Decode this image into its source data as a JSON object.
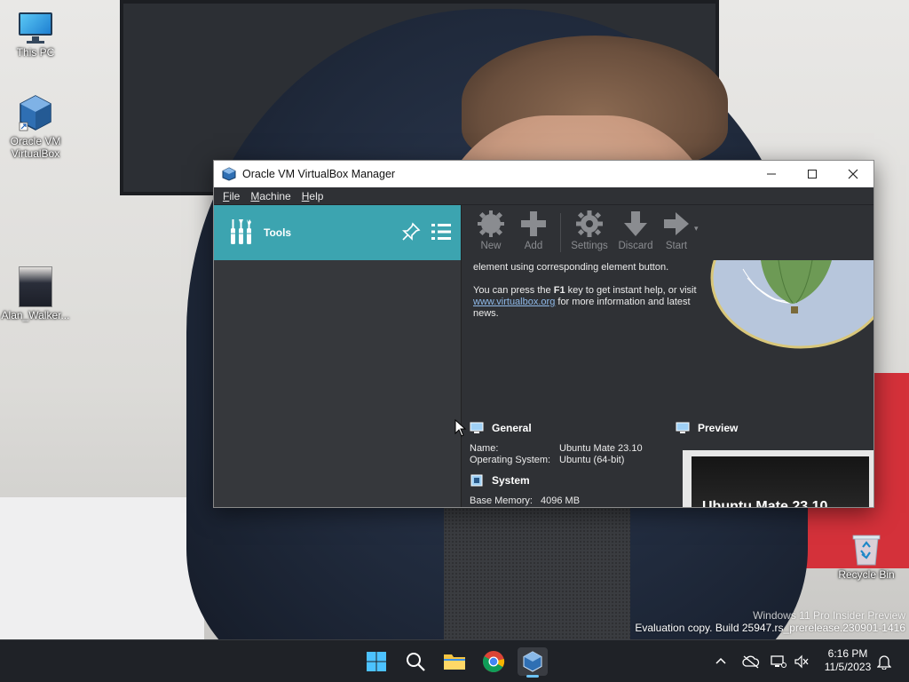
{
  "desktop": {
    "icons": [
      {
        "label": "This PC",
        "icon": "computer-icon"
      },
      {
        "label": "Oracle VM VirtualBox",
        "icon": "virtualbox-icon"
      },
      {
        "label": "Alan_Walker...",
        "icon": "photo-file-icon"
      },
      {
        "label": "Recycle Bin",
        "icon": "recycle-bin-icon"
      }
    ],
    "watermark": {
      "line1": "Windows 11 Pro Insider Preview",
      "line2": "Evaluation copy. Build 25947.rs_prerelease.230901-1416"
    }
  },
  "window": {
    "title": "Oracle VM VirtualBox Manager",
    "controls": {
      "minimize": "—",
      "maximize": "☐",
      "close": "✕"
    },
    "menu": [
      {
        "accel": "F",
        "rest": "ile"
      },
      {
        "accel": "M",
        "rest": "achine"
      },
      {
        "accel": "H",
        "rest": "elp"
      }
    ],
    "sidebar": {
      "tools_label": "Tools"
    },
    "toolbar": [
      {
        "label": "New",
        "icon": "new-gear-icon"
      },
      {
        "label": "Add",
        "icon": "add-plus-icon"
      },
      {
        "label": "Settings",
        "icon": "settings-gear-icon"
      },
      {
        "label": "Discard",
        "icon": "discard-arrow-down-icon"
      },
      {
        "label": "Start",
        "icon": "start-arrow-right-icon"
      }
    ],
    "welcome": {
      "line1": "element using corresponding element button.",
      "help_prefix": "You can press the ",
      "help_key": "F1",
      "help_mid": " key to get instant help, or visit ",
      "help_link": "www.virtualbox.org",
      "help_suffix": " for more information and latest news."
    },
    "details": {
      "general": {
        "title": "General",
        "name_label": "Name:",
        "name_value": "Ubuntu Mate 23.10",
        "os_label": "Operating System:",
        "os_value": "Ubuntu (64-bit)"
      },
      "system": {
        "title": "System",
        "memory_label": "Base Memory:",
        "memory_value": "4096 MB"
      },
      "preview": {
        "title": "Preview",
        "screen_text": "Ubuntu Mate 23.10"
      }
    }
  },
  "taskbar": {
    "apps": [
      "start-icon",
      "search-icon",
      "file-explorer-icon",
      "chrome-icon",
      "virtualbox-icon"
    ],
    "time": "6:16 PM",
    "date": "11/5/2023"
  },
  "colors": {
    "tools_accent": "#3ca4b0",
    "window_bg": "#2f3135",
    "taskbar_bg": "#1f2227",
    "link": "#8fb9e8"
  }
}
